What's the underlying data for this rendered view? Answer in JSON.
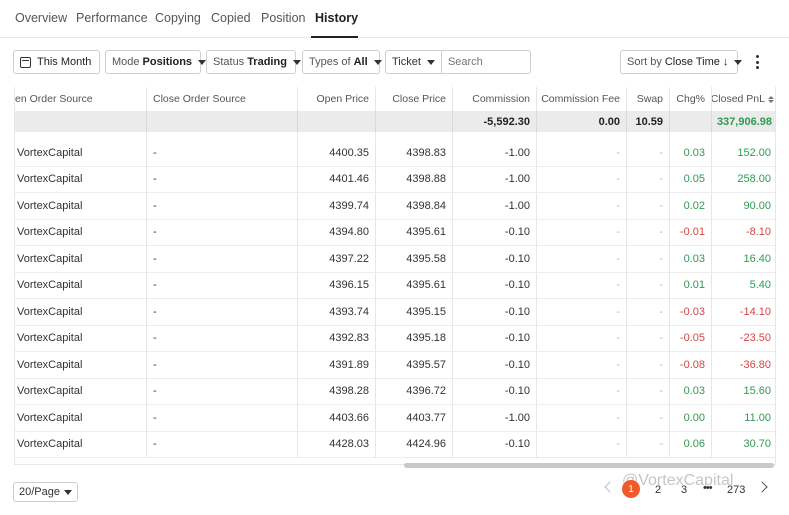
{
  "tabs": [
    {
      "label": "Overview"
    },
    {
      "label": "Performance"
    },
    {
      "label": "Copying"
    },
    {
      "label": "Copied"
    },
    {
      "label": "Position"
    },
    {
      "label": "History"
    }
  ],
  "toolbar": {
    "date_range": "This Month",
    "mode_label": "Mode",
    "mode_value": "Positions",
    "status_label": "Status",
    "status_value": "Trading",
    "types_label": "Types of",
    "types_value": "All",
    "ticket_label": "Ticket",
    "search_placeholder": "Search",
    "sort_label": "Sort by",
    "sort_value": "Close Time ↓"
  },
  "table": {
    "headers": [
      "en Order Source",
      "Close Order Source",
      "Open Price",
      "Close Price",
      "Commission",
      "Commission Fee",
      "Swap",
      "Chg%",
      "Closed PnL"
    ],
    "summary": {
      "commission": "-5,592.30",
      "commission_fee": "0.00",
      "swap": "10.59",
      "closed_pnl": "337,906.98"
    },
    "rows": [
      {
        "open_source": "VortexCapital",
        "close_source": "-",
        "open_price": "4400.35",
        "close_price": "4398.83",
        "commission": "-1.00",
        "commission_fee": "-",
        "swap": "-",
        "chg": "0.03",
        "pnl": "152.00",
        "sign": "pos"
      },
      {
        "open_source": "VortexCapital",
        "close_source": "-",
        "open_price": "4401.46",
        "close_price": "4398.88",
        "commission": "-1.00",
        "commission_fee": "-",
        "swap": "-",
        "chg": "0.05",
        "pnl": "258.00",
        "sign": "pos"
      },
      {
        "open_source": "VortexCapital",
        "close_source": "-",
        "open_price": "4399.74",
        "close_price": "4398.84",
        "commission": "-1.00",
        "commission_fee": "-",
        "swap": "-",
        "chg": "0.02",
        "pnl": "90.00",
        "sign": "pos"
      },
      {
        "open_source": "VortexCapital",
        "close_source": "-",
        "open_price": "4394.80",
        "close_price": "4395.61",
        "commission": "-0.10",
        "commission_fee": "-",
        "swap": "-",
        "chg": "-0.01",
        "pnl": "-8.10",
        "sign": "neg"
      },
      {
        "open_source": "VortexCapital",
        "close_source": "-",
        "open_price": "4397.22",
        "close_price": "4395.58",
        "commission": "-0.10",
        "commission_fee": "-",
        "swap": "-",
        "chg": "0.03",
        "pnl": "16.40",
        "sign": "pos"
      },
      {
        "open_source": "VortexCapital",
        "close_source": "-",
        "open_price": "4396.15",
        "close_price": "4395.61",
        "commission": "-0.10",
        "commission_fee": "-",
        "swap": "-",
        "chg": "0.01",
        "pnl": "5.40",
        "sign": "pos"
      },
      {
        "open_source": "VortexCapital",
        "close_source": "-",
        "open_price": "4393.74",
        "close_price": "4395.15",
        "commission": "-0.10",
        "commission_fee": "-",
        "swap": "-",
        "chg": "-0.03",
        "pnl": "-14.10",
        "sign": "neg"
      },
      {
        "open_source": "VortexCapital",
        "close_source": "-",
        "open_price": "4392.83",
        "close_price": "4395.18",
        "commission": "-0.10",
        "commission_fee": "-",
        "swap": "-",
        "chg": "-0.05",
        "pnl": "-23.50",
        "sign": "neg"
      },
      {
        "open_source": "VortexCapital",
        "close_source": "-",
        "open_price": "4391.89",
        "close_price": "4395.57",
        "commission": "-0.10",
        "commission_fee": "-",
        "swap": "-",
        "chg": "-0.08",
        "pnl": "-36.80",
        "sign": "neg"
      },
      {
        "open_source": "VortexCapital",
        "close_source": "-",
        "open_price": "4398.28",
        "close_price": "4396.72",
        "commission": "-0.10",
        "commission_fee": "-",
        "swap": "-",
        "chg": "0.03",
        "pnl": "15.60",
        "sign": "pos"
      },
      {
        "open_source": "VortexCapital",
        "close_source": "-",
        "open_price": "4403.66",
        "close_price": "4403.77",
        "commission": "-1.00",
        "commission_fee": "-",
        "swap": "-",
        "chg": "0.00",
        "pnl": "11.00",
        "sign": "pos"
      },
      {
        "open_source": "VortexCapital",
        "close_source": "-",
        "open_price": "4428.03",
        "close_price": "4424.96",
        "commission": "-0.10",
        "commission_fee": "-",
        "swap": "-",
        "chg": "0.06",
        "pnl": "30.70",
        "sign": "pos"
      }
    ]
  },
  "footer": {
    "page_size": "20/Page",
    "pages": [
      "1",
      "2",
      "3",
      "273"
    ],
    "ellipsis": "•••",
    "watermark": "@VortexCapital"
  },
  "colors": {
    "positive": "#2e9c4f",
    "negative": "#d64545",
    "accent": "#f05a28"
  }
}
